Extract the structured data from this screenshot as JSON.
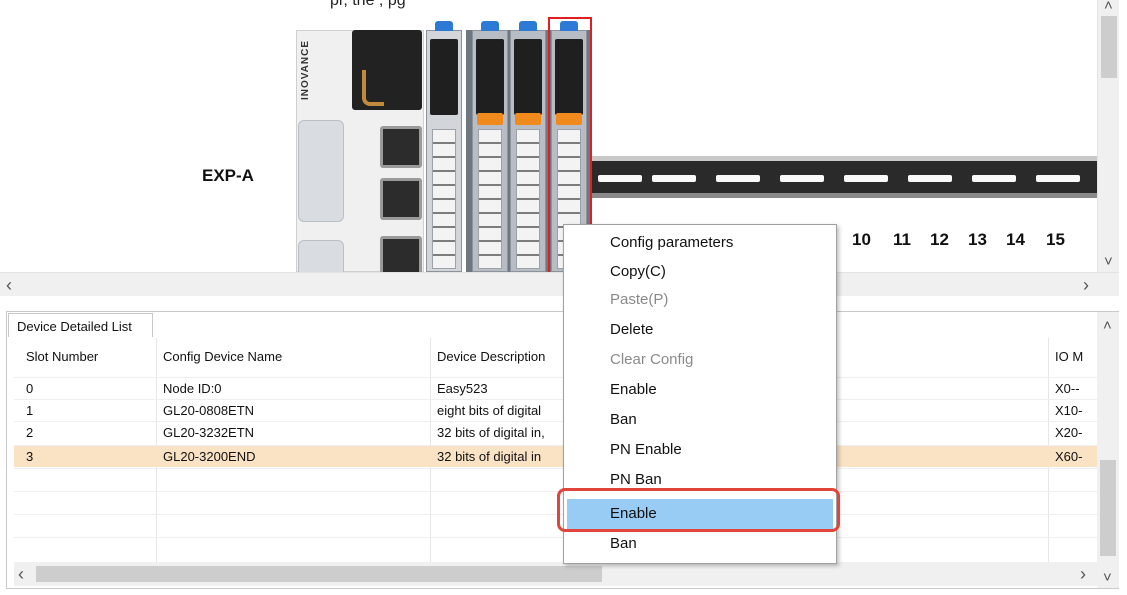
{
  "caption": "pr,   the   ,   pg",
  "canvas": {
    "exp_label": "EXP-A",
    "brand": "INOVANCE",
    "slot_numbers": [
      "10",
      "11",
      "12",
      "13",
      "14",
      "15"
    ]
  },
  "bottom_panel": {
    "tab_label": "Device Detailed List",
    "columns": [
      "Slot Number",
      "Config Device Name",
      "Device Description",
      "IO M"
    ],
    "rows": [
      {
        "slot": "0",
        "name": "Node ID:0",
        "desc": "Easy523",
        "io": "X0--"
      },
      {
        "slot": "1",
        "name": "GL20-0808ETN",
        "desc": "eight bits of digital",
        "io": "X10-"
      },
      {
        "slot": "2",
        "name": "GL20-3232ETN",
        "desc": "32 bits of digital in,",
        "io": "X20-"
      },
      {
        "slot": "3",
        "name": "GL20-3200END",
        "desc": "32 bits of digital in",
        "io": "X60-"
      }
    ],
    "selected_row": 3
  },
  "context_menu": {
    "items": [
      {
        "label": "Config parameters",
        "enabled": true
      },
      {
        "label": "Copy(C)",
        "enabled": true
      },
      {
        "label": "Paste(P)",
        "enabled": false
      },
      {
        "label": "Delete",
        "enabled": true
      },
      {
        "label": "Clear Config",
        "enabled": false
      },
      {
        "label": "Enable",
        "enabled": true
      },
      {
        "label": "Ban",
        "enabled": true
      },
      {
        "label": "PN Enable",
        "enabled": true
      },
      {
        "label": "PN Ban",
        "enabled": true
      },
      {
        "label": "Enable",
        "enabled": true,
        "highlighted": true
      },
      {
        "label": "Ban",
        "enabled": true
      }
    ]
  },
  "colors": {
    "selected_row": "#fae3c4",
    "menu_highlight": "#99ccf5",
    "callout_red": "#e0443a",
    "module_cap_blue": "#2c7ad6",
    "module_orange": "#f08a1c"
  },
  "icons": {
    "scroll_left": "‹",
    "scroll_right": "›",
    "scroll_up": "˄",
    "scroll_down": "˅"
  }
}
